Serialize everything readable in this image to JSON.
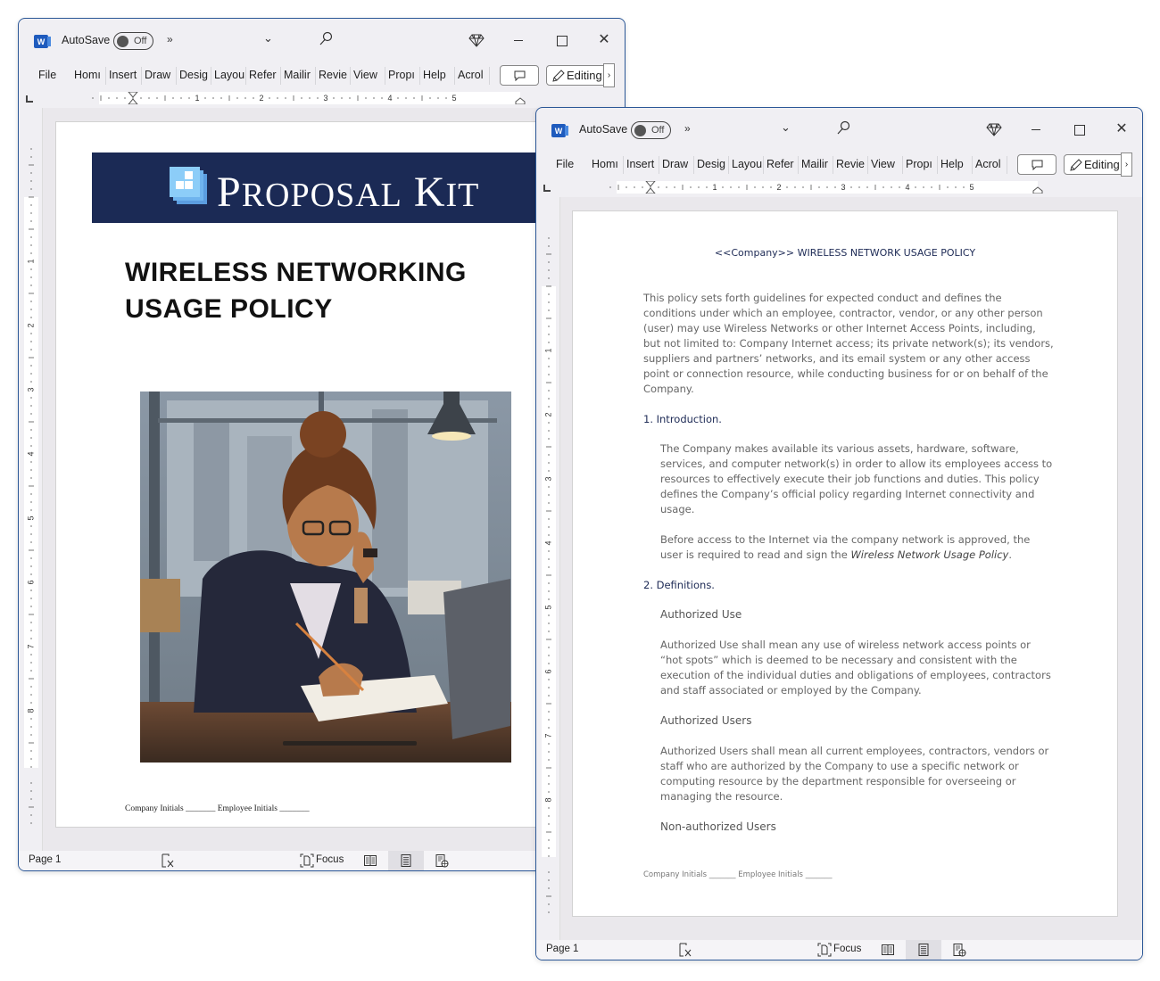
{
  "windows": [
    {
      "id": "cover",
      "titlebar": {
        "app_icon": "word-icon",
        "autosave_label": "AutoSave",
        "autosave_state": "Off",
        "more_icon": "double-chevron-right-icon",
        "dropdown_icon": "chevron-down-icon",
        "search_icon": "search-icon",
        "premium_icon": "diamond-icon",
        "minimize_icon": "minimize-icon",
        "maximize_icon": "maximize-icon",
        "close_icon": "close-icon"
      },
      "ribbon": {
        "tabs": [
          "File",
          "Homı",
          "Insert",
          "Draw",
          "Desig",
          "Layou",
          "Refer",
          "Mailir",
          "Revie",
          "View",
          "Propı",
          "Help",
          "Acrol"
        ],
        "comment_icon": "comment-icon",
        "editing_label": "Editing",
        "editing_icon": "pencil-icon",
        "more_label": "›"
      },
      "ruler": {
        "h_numbers": [
          "1",
          "2",
          "3",
          "4",
          "5"
        ],
        "v_numbers": [
          "1",
          "2",
          "3",
          "4",
          "5",
          "6",
          "7",
          "8"
        ]
      },
      "page": {
        "brand": {
          "text_first": "P",
          "text_rest": "ROPOSAL",
          "text2_first": "K",
          "text2_rest": "IT"
        },
        "title_line1": "WIRELESS NETWORKING",
        "title_line2": "USAGE POLICY",
        "image_alt": "Illustration of a woman in glasses writing at a desk",
        "footer": "Company Initials _______ Employee Initials _______"
      },
      "statusbar": {
        "page_label": "Page 1",
        "focus_label": "Focus"
      }
    },
    {
      "id": "policy",
      "titlebar": {
        "app_icon": "word-icon",
        "autosave_label": "AutoSave",
        "autosave_state": "Off"
      },
      "ribbon": {
        "tabs": [
          "File",
          "Homı",
          "Insert",
          "Draw",
          "Desig",
          "Layou",
          "Refer",
          "Mailir",
          "Revie",
          "View",
          "Propı",
          "Help",
          "Acrol"
        ],
        "editing_label": "Editing",
        "more_label": "›"
      },
      "ruler": {
        "h_numbers": [
          "1",
          "2",
          "3",
          "4",
          "5"
        ],
        "v_numbers": [
          "1",
          "2",
          "3",
          "4",
          "5",
          "6",
          "7",
          "8"
        ]
      },
      "page": {
        "title": "<<Company>> WIRELESS NETWORK USAGE POLICY",
        "intro": "This policy sets forth guidelines for expected conduct and defines the conditions under which an employee, contractor, vendor, or any other person (user) may use Wireless Networks or other Internet Access Points, including, but not limited to: Company Internet access; its private network(s); its vendors, suppliers and partners’ networks, and its email system or any other access point or connection resource, while conducting business for or on behalf of the Company.",
        "section1_heading": "1. Introduction.",
        "section1_para1": "The Company makes available its various assets, hardware, software, services, and computer network(s) in order to allow its employees access to resources to effectively execute their job functions and duties. This policy defines the Company’s official policy regarding Internet connectivity and usage.",
        "section1_para2_start": "Before access to the Internet via the company network is approved, the user is required to read and sign the ",
        "section1_para2_em": "Wireless Network Usage Policy",
        "section1_para2_end": ".",
        "section2_heading": "2. Definitions.",
        "def1_heading": "Authorized Use",
        "def1_text": "Authorized Use shall mean any use of wireless network access points or “hot spots” which is deemed to be necessary and consistent with the execution of the individual duties and obligations of employees, contractors and staff associated or employed by the Company.",
        "def2_heading": "Authorized Users",
        "def2_text": "Authorized Users shall mean all current employees, contractors, vendors or staff who are authorized by the Company to use a specific network or computing resource by the department responsible for overseeing or managing the resource.",
        "def3_heading": "Non-authorized Users",
        "footer": "Company Initials _______ Employee Initials _______"
      },
      "statusbar": {
        "page_label": "Page 1",
        "focus_label": "Focus"
      }
    }
  ]
}
